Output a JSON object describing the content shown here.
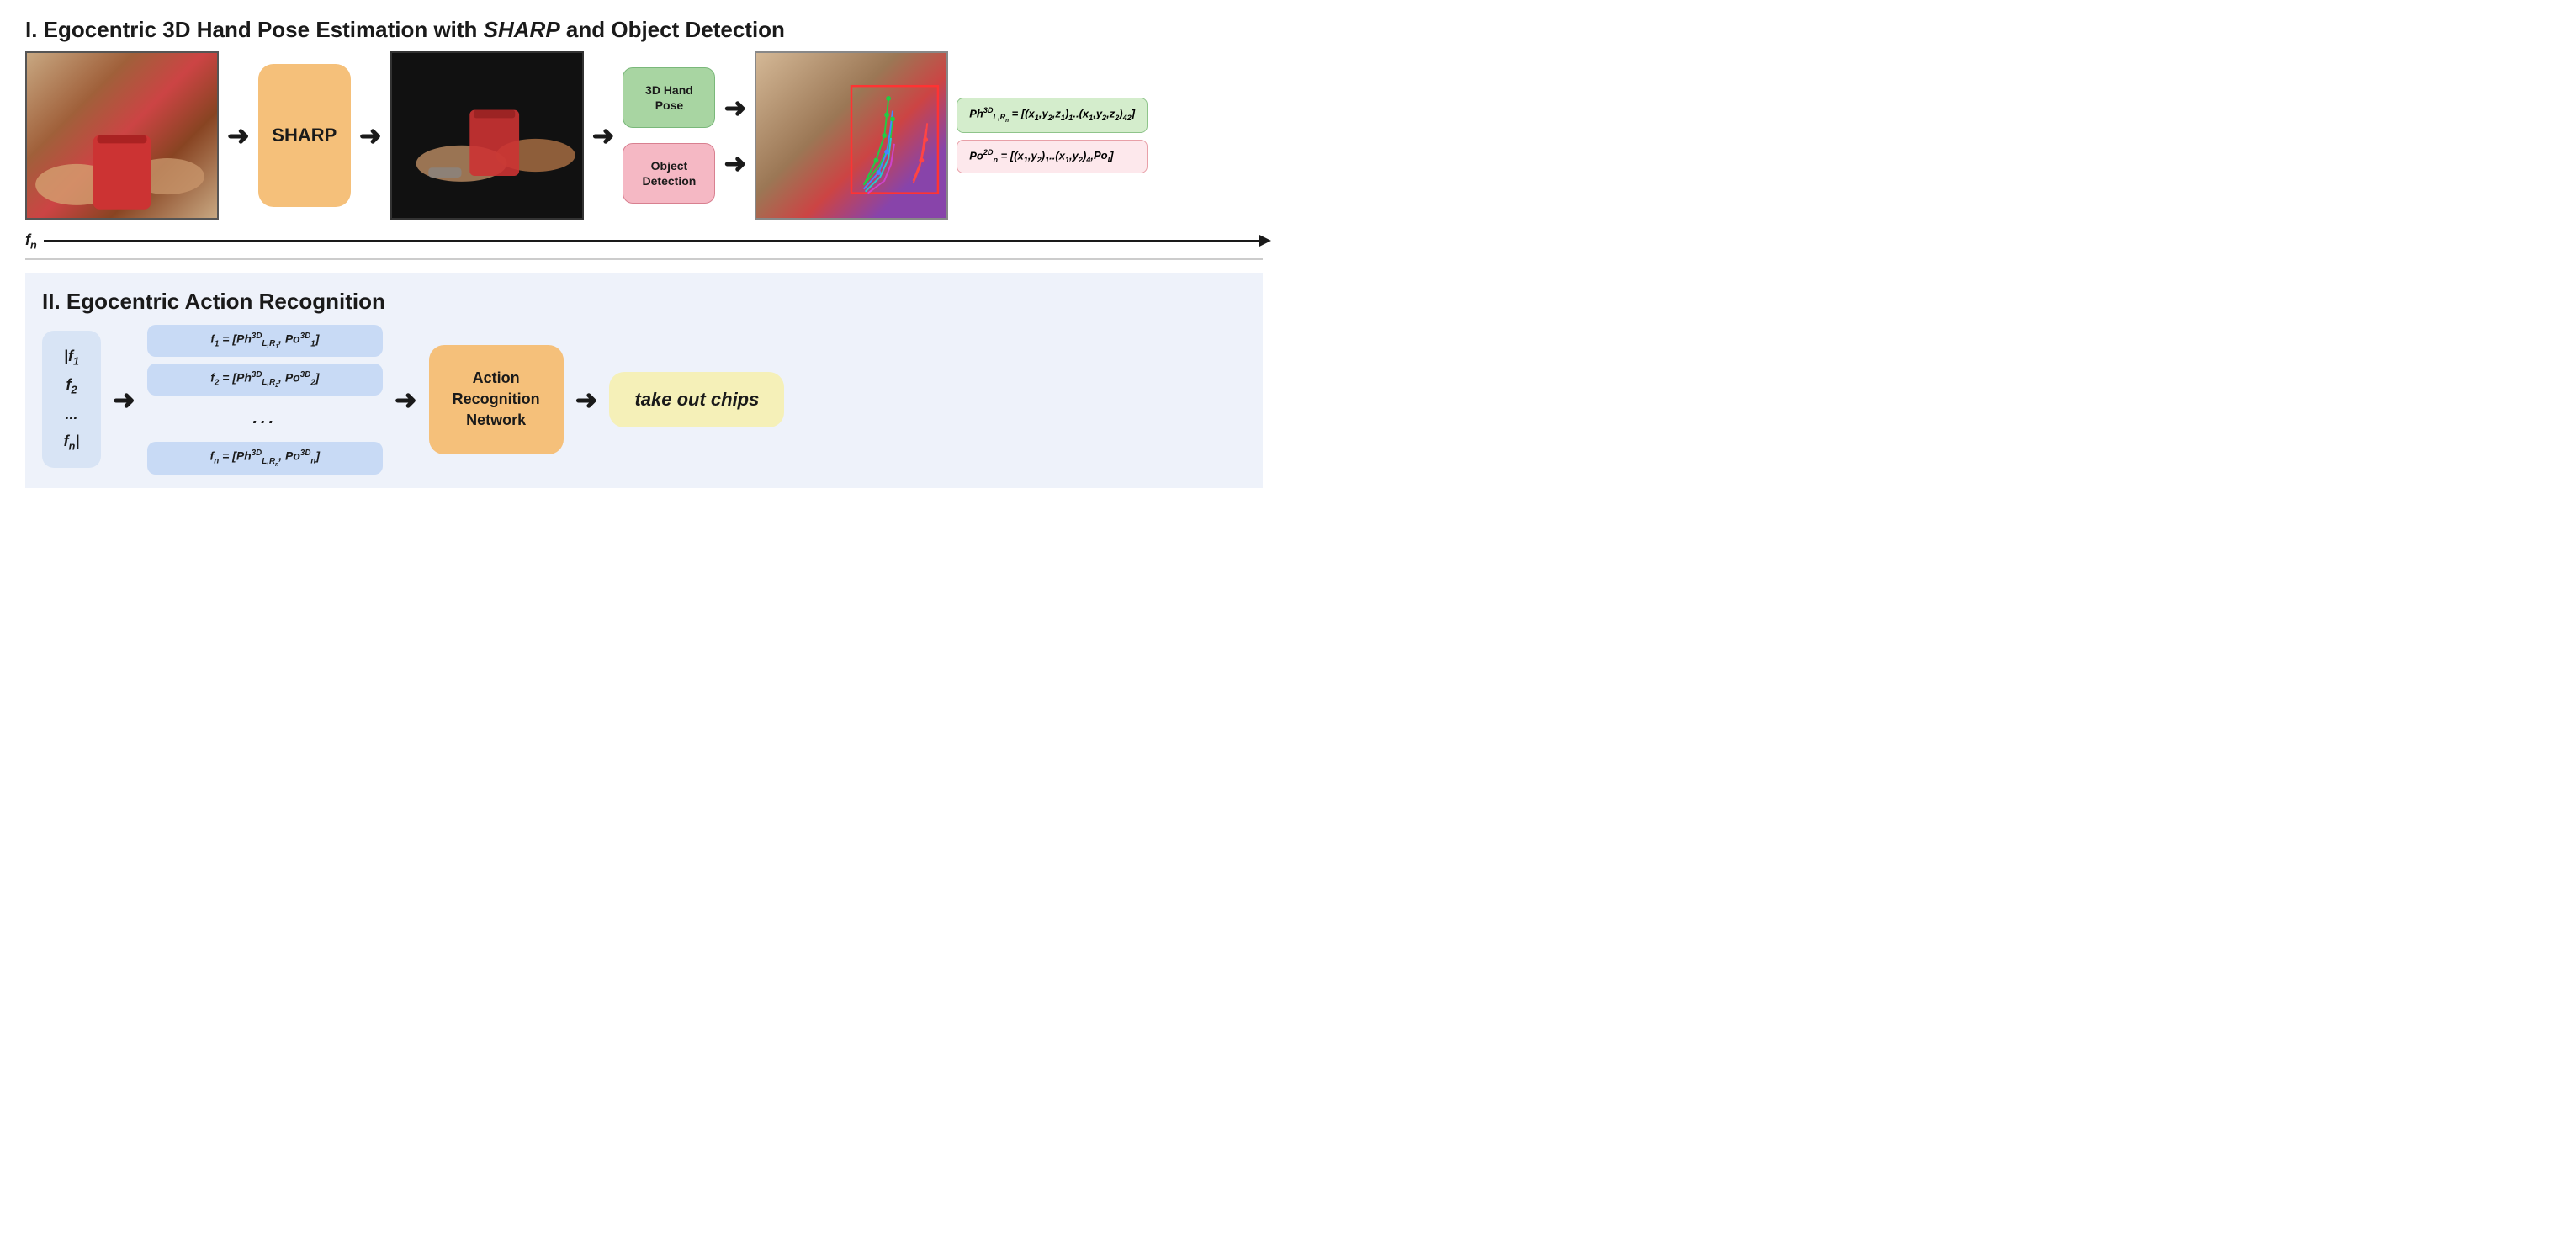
{
  "section1": {
    "title_prefix": "I. Egocentric 3D Hand Pose Estimation with ",
    "title_sharp": "SHARP",
    "title_suffix": " and Object Detection",
    "sharp_label": "SHARP",
    "output1_label": "3D Hand\nPose",
    "output2_label": "Object\nDetection",
    "formula1": "Ph³ᴰ_{L,Rₙ} = [(x₁,y₂,z₁)₁..(x₁,y₂,z₂)₄₂]",
    "formula2": "Po²ᴰₙ = [(x₁,y₂)₁..(x₁,y₂)₄,Poₗ]",
    "fn_label": "fₙ"
  },
  "section2": {
    "title": "II. Egocentric Action Recognition",
    "frame_list": "|f₁\nf₂\n...\nfₙ|",
    "frame_list_lines": [
      "f₁",
      "f₂",
      "...",
      "fₙ"
    ],
    "feature_frames": [
      "f₁ = [Ph³ᴰ_{L,R₁}, Po³ᴰ₁]",
      "f₂ = [Ph³ᴰ_{L,R₂}, Po³ᴰ₂]",
      "...",
      "fₙ = [Ph³ᴰ_{L,Rₙ}, Po³ᴰₙ]"
    ],
    "action_network_label": "Action\nRecognition\nNetwork",
    "result_label": "take out chips"
  }
}
